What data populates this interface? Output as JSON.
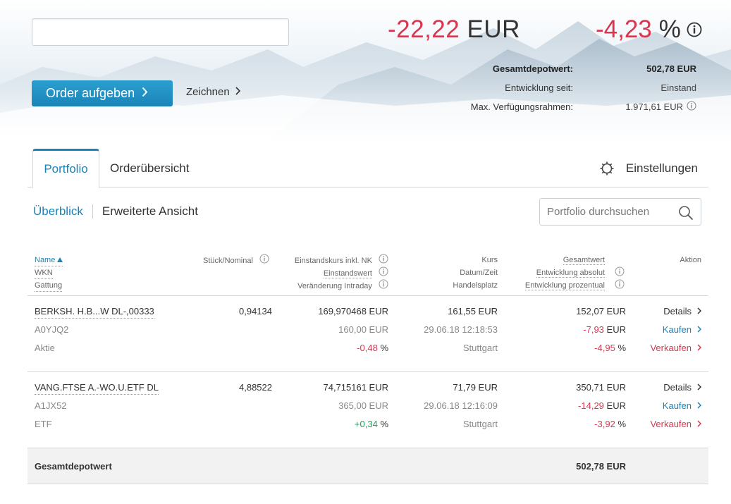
{
  "header": {
    "search": {
      "value": "",
      "placeholder": ""
    },
    "order_button": "Order aufgeben",
    "zeichnen_link": "Zeichnen",
    "performance_abs": {
      "value": "-22,22",
      "unit": "EUR"
    },
    "performance_pct": {
      "value": "-4,23",
      "unit": "%"
    },
    "summary": [
      {
        "label": "Gesamtdepotwert:",
        "value": "502,78 EUR"
      },
      {
        "label": "Entwicklung seit:",
        "value": "Einstand"
      },
      {
        "label": "Max. Verfügungsrahmen:",
        "value": "1.971,61 EUR"
      }
    ]
  },
  "tabs": {
    "portfolio": "Portfolio",
    "orders": "Orderübersicht",
    "settings": "Einstellungen"
  },
  "subnav": {
    "overview": "Überblick",
    "extended": "Erweiterte Ansicht",
    "search_placeholder": "Portfolio durchsuchen"
  },
  "table": {
    "headers": {
      "name": "Name",
      "wkn": "WKN",
      "gattung": "Gattung",
      "stueck": "Stück/Nominal",
      "einstandskurs": "Einstandskurs inkl. NK",
      "einstandswert": "Einstandswert",
      "veraenderung": "Veränderung Intraday",
      "kurs": "Kurs",
      "datum": "Datum/Zeit",
      "handelsplatz": "Handelsplatz",
      "gesamtwert": "Gesamtwert",
      "entw_abs": "Entwicklung absolut",
      "entw_pct": "Entwicklung prozentual",
      "aktion": "Aktion"
    },
    "rows": [
      {
        "name": "BERKSH. H.B...W DL-,00333",
        "wkn": "A0YJQ2",
        "gattung": "Aktie",
        "stueck": "0,94134",
        "einstandskurs": "169,970468 EUR",
        "einstandswert": "160,00 EUR",
        "intraday": "-0,48",
        "intraday_unit": "%",
        "kurs": "161,55 EUR",
        "datum": "29.06.18 12:18:53",
        "handelsplatz": "Stuttgart",
        "gesamtwert": "152,07 EUR",
        "entw_abs": "-7,93",
        "entw_abs_unit": "EUR",
        "entw_pct": "-4,95",
        "entw_pct_unit": "%",
        "action_details": "Details",
        "action_buy": "Kaufen",
        "action_sell": "Verkaufen"
      },
      {
        "name": "VANG.FTSE A.-WO.U.ETF DL",
        "wkn": "A1JX52",
        "gattung": "ETF",
        "stueck": "4,88522",
        "einstandskurs": "74,715161 EUR",
        "einstandswert": "365,00 EUR",
        "intraday": "+0,34",
        "intraday_unit": "%",
        "kurs": "71,79 EUR",
        "datum": "29.06.18 12:16:09",
        "handelsplatz": "Stuttgart",
        "gesamtwert": "350,71 EUR",
        "entw_abs": "-14,29",
        "entw_abs_unit": "EUR",
        "entw_pct": "-3,92",
        "entw_pct_unit": "%",
        "action_details": "Details",
        "action_buy": "Kaufen",
        "action_sell": "Verkaufen"
      }
    ],
    "total": {
      "label": "Gesamtdepotwert",
      "value": "502,78 EUR"
    }
  },
  "colors": {
    "accent": "#1a84b8",
    "negative": "#d9364f",
    "positive": "#1f9b58"
  }
}
